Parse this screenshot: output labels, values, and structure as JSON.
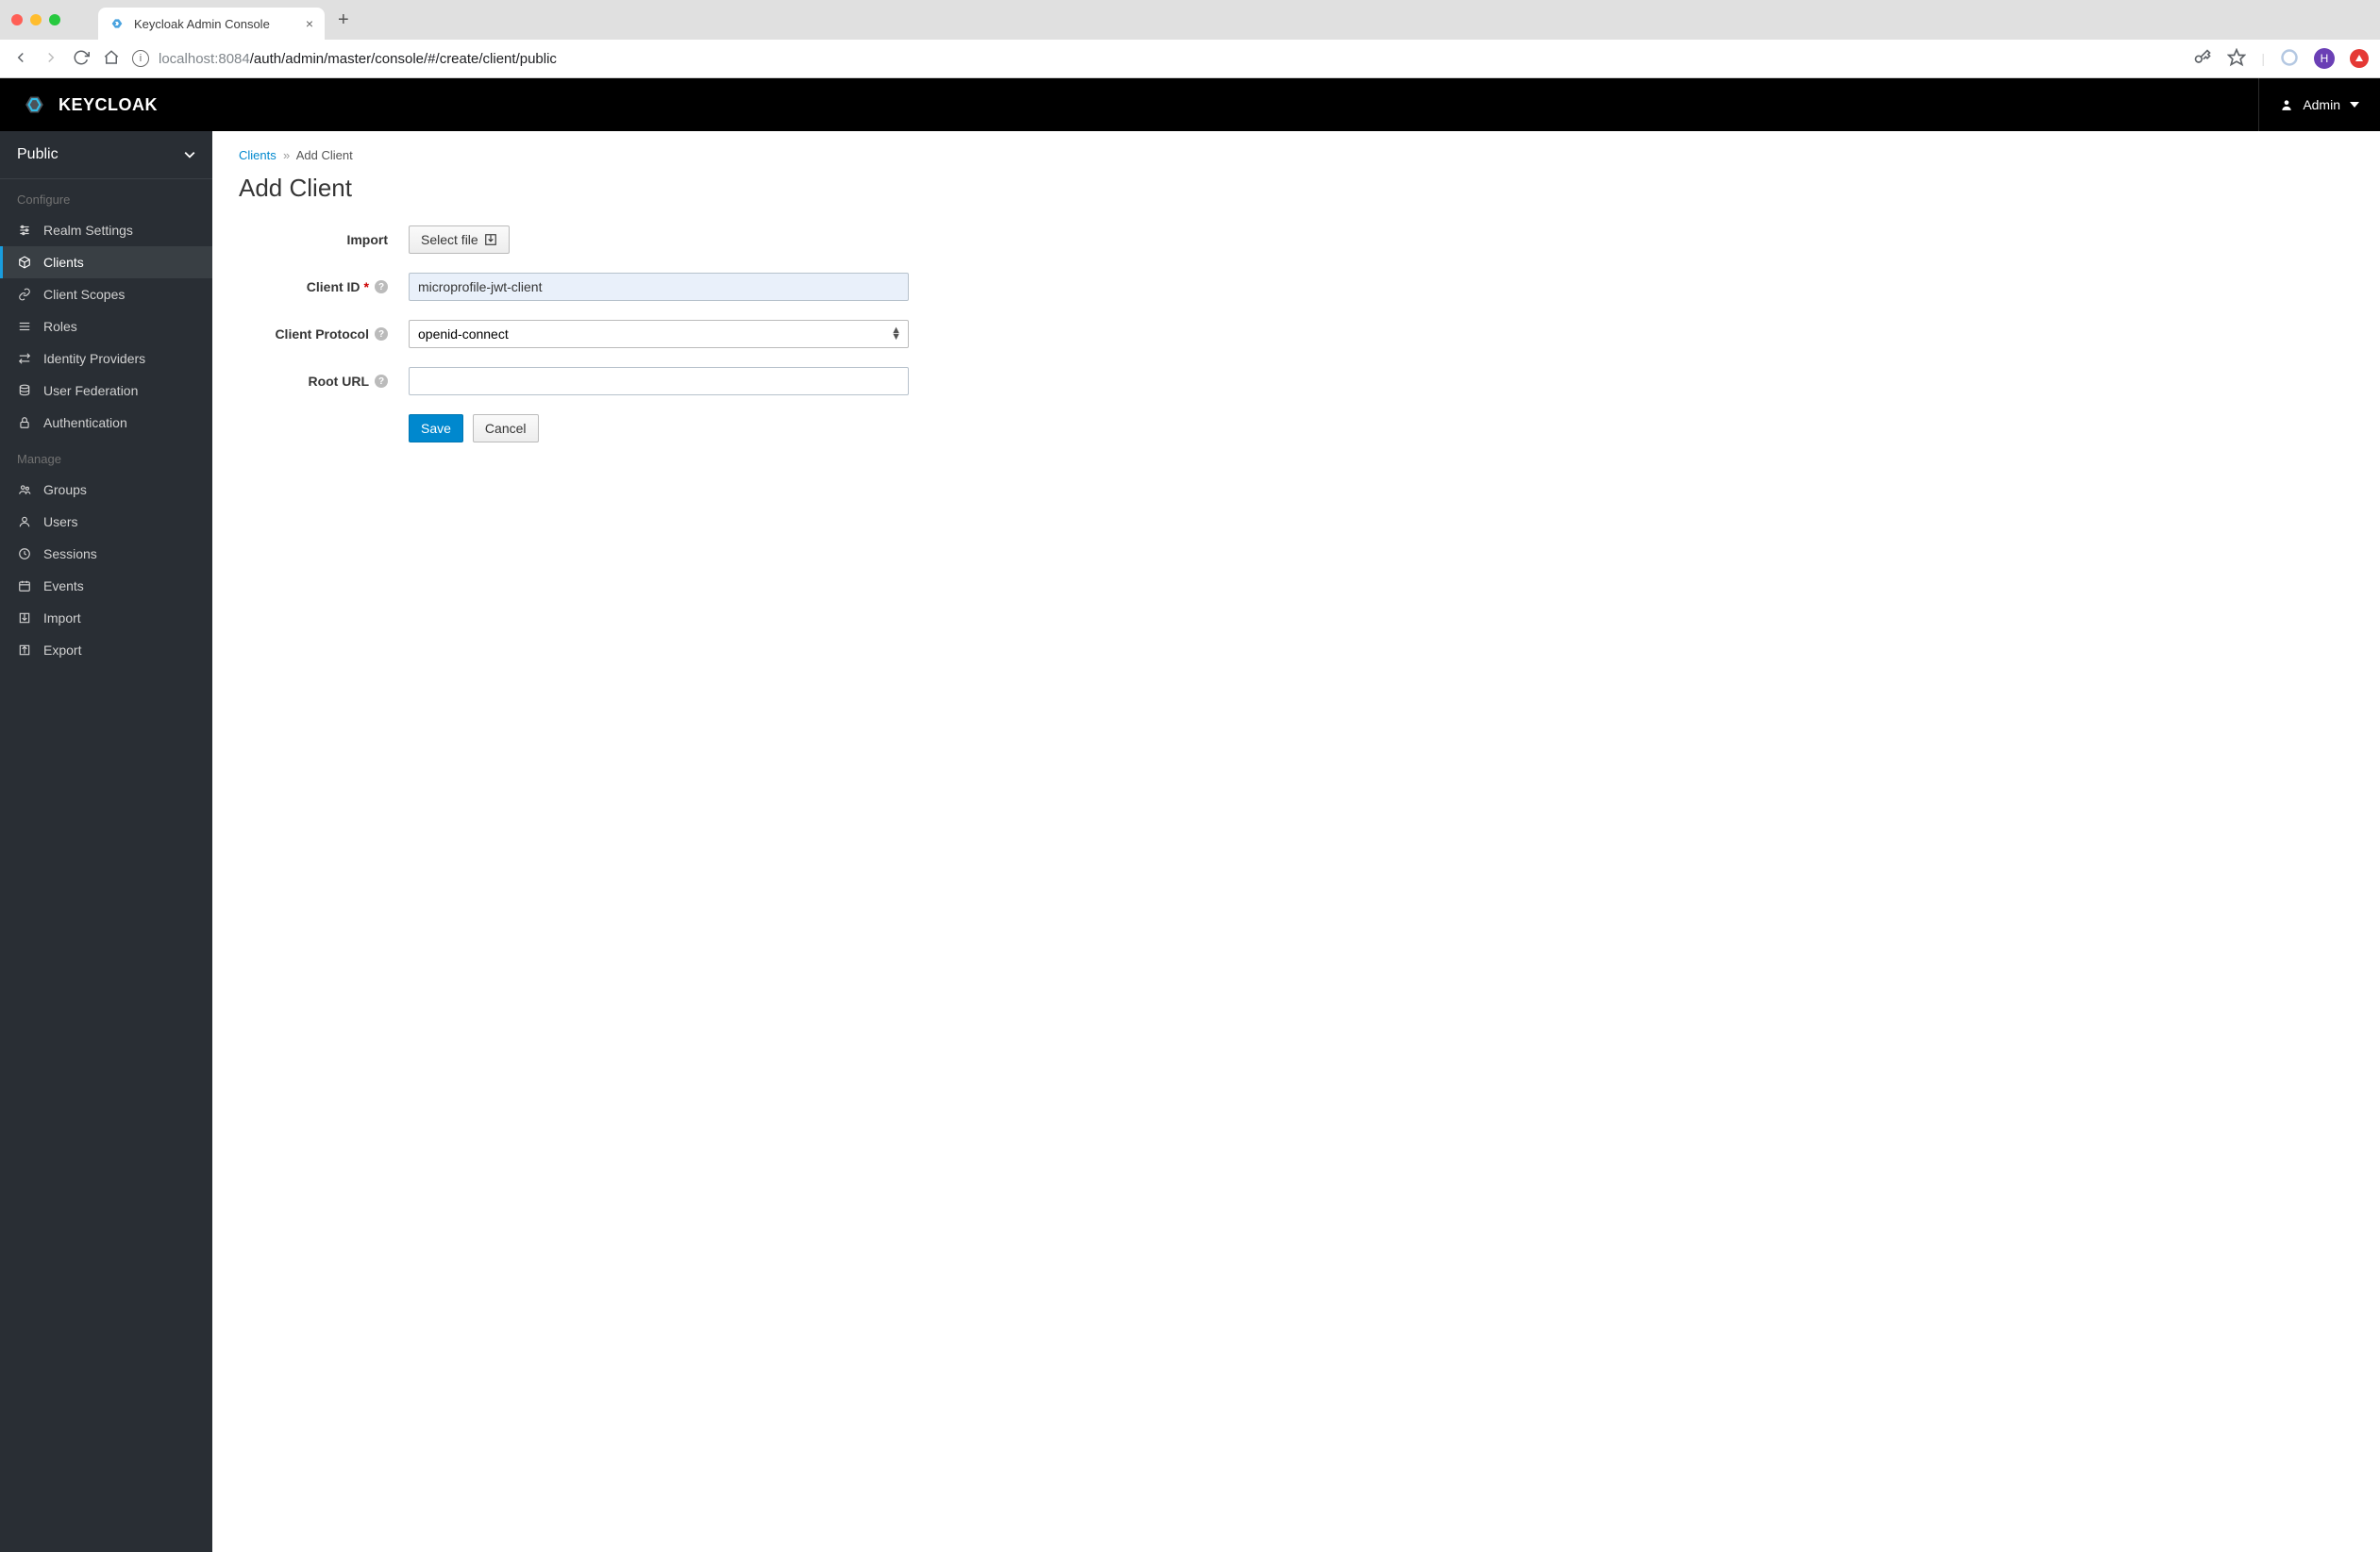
{
  "browser": {
    "tab_title": "Keycloak Admin Console",
    "url_host_grey1": "localhost",
    "url_port": ":8084",
    "url_path": "/auth/admin/master/console/#/create/client/public",
    "profile_initial": "H"
  },
  "header": {
    "brand": "KEYCLOAK",
    "user": "Admin"
  },
  "sidebar": {
    "realm": "Public",
    "configure_label": "Configure",
    "manage_label": "Manage",
    "configure": [
      {
        "label": "Realm Settings",
        "icon": "sliders"
      },
      {
        "label": "Clients",
        "icon": "cube",
        "active": true
      },
      {
        "label": "Client Scopes",
        "icon": "link"
      },
      {
        "label": "Roles",
        "icon": "bars"
      },
      {
        "label": "Identity Providers",
        "icon": "exchange"
      },
      {
        "label": "User Federation",
        "icon": "database"
      },
      {
        "label": "Authentication",
        "icon": "lock"
      }
    ],
    "manage": [
      {
        "label": "Groups",
        "icon": "group"
      },
      {
        "label": "Users",
        "icon": "user"
      },
      {
        "label": "Sessions",
        "icon": "clock"
      },
      {
        "label": "Events",
        "icon": "calendar"
      },
      {
        "label": "Import",
        "icon": "import"
      },
      {
        "label": "Export",
        "icon": "export"
      }
    ]
  },
  "breadcrumb": {
    "root": "Clients",
    "sep": "»",
    "current": "Add Client"
  },
  "page_title": "Add Client",
  "form": {
    "import_label": "Import",
    "select_file": "Select file",
    "client_id_label": "Client ID",
    "client_id_value": "microprofile-jwt-client",
    "protocol_label": "Client Protocol",
    "protocol_value": "openid-connect",
    "root_url_label": "Root URL",
    "root_url_value": "",
    "save": "Save",
    "cancel": "Cancel"
  }
}
